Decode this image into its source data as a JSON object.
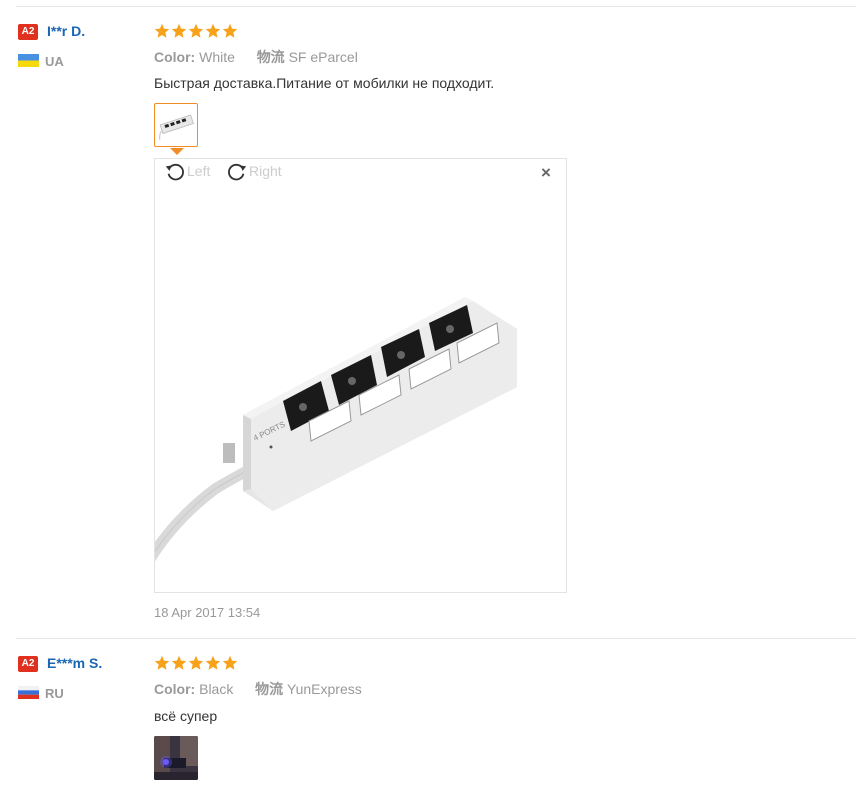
{
  "reviews": [
    {
      "badge": "A2",
      "name": "I**r D.",
      "country": "UA",
      "rating": 5,
      "color_label": "Color:",
      "color_value": "White",
      "ship_label": "物流",
      "ship_value": "SF eParcel",
      "text": "Быстрая доставка.Питание от мобилки не подходит.",
      "viewer": {
        "rotate_left": "Left",
        "rotate_right": "Right",
        "close": "×"
      },
      "date": "18 Apr 2017 13:54"
    },
    {
      "badge": "A2",
      "name": "E***m S.",
      "country": "RU",
      "rating": 5,
      "color_label": "Color:",
      "color_value": "Black",
      "ship_label": "物流",
      "ship_value": "YunExpress",
      "text": "всё супер"
    }
  ],
  "colors": {
    "accent": "#f28c28",
    "name": "#1a66b3",
    "badge": "#e0301e",
    "star": "#f7a21b"
  }
}
